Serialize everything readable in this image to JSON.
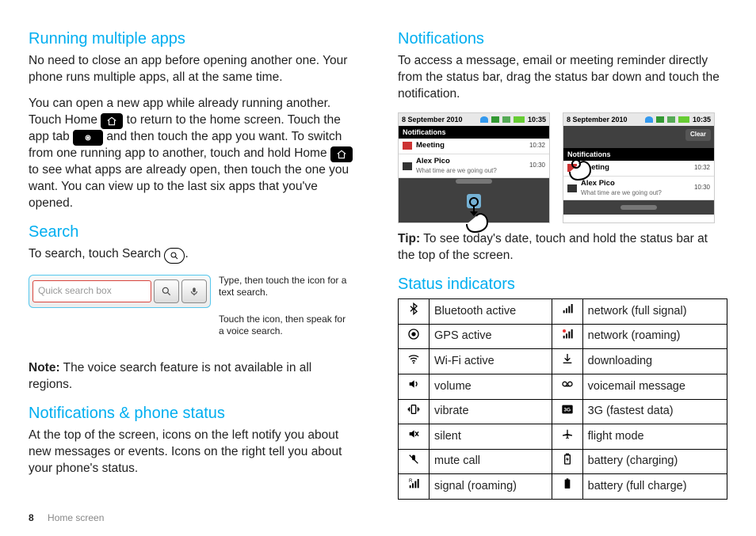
{
  "left": {
    "h_running": "Running multiple apps",
    "p_running_1": "No need to close an app before opening another one. Your phone runs multiple apps, all at the same time.",
    "p_running_2a": "You can open a new app while already running another. Touch Home ",
    "p_running_2b": " to return to the home screen. Touch the app tab ",
    "p_running_2c": " and then touch the app you want. To switch from one running app to another, touch and hold Home ",
    "p_running_2d": " to see what apps are already open, then touch the one you want. You can view up to the last six apps that you've opened.",
    "h_search": "Search",
    "p_search_1a": "To search, touch Search ",
    "p_search_1b": ".",
    "searchbox_placeholder": "Quick search box",
    "search_annot_1": "Type, then touch the icon for a text search.",
    "search_annot_2": "Touch the icon, then speak for a voice search.",
    "note_label": "Note:",
    "note_text": " The voice search feature is not available in all regions.",
    "h_notifstatus": "Notifications & phone status",
    "p_notifstatus": "At the top of the screen, icons on the left notify you about new messages or events. Icons on the right tell you about your phone's status."
  },
  "right": {
    "h_notif": "Notifications",
    "p_notif": "To access a message, email or meeting reminder directly from the status bar, drag the status bar down and touch the notification.",
    "phone_date": "8 September 2010",
    "phone_time": "10:35",
    "shade_title": "Notifications",
    "clear_label": "Clear",
    "n1_label": "Meeting",
    "n1_time": "10:32",
    "n2_label": "Alex Pico",
    "n2_sub": "What time are we going out?",
    "n2_time": "10:30",
    "tip_label": "Tip:",
    "tip_text": " To see today's date, touch and hold the status bar at the top of the screen.",
    "h_status": "Status indicators",
    "rows": [
      {
        "l": "Bluetooth active",
        "r": "network (full signal)"
      },
      {
        "l": "GPS active",
        "r": "network (roaming)"
      },
      {
        "l": "Wi-Fi active",
        "r": "downloading"
      },
      {
        "l": "volume",
        "r": "voicemail message"
      },
      {
        "l": "vibrate",
        "r": "3G (fastest data)"
      },
      {
        "l": "silent",
        "r": "flight mode"
      },
      {
        "l": "mute call",
        "r": "battery (charging)"
      },
      {
        "l": "signal (roaming)",
        "r": "battery (full charge)"
      }
    ],
    "icons_l": [
      "bluetooth",
      "gps",
      "wifi",
      "volume",
      "vibrate",
      "silent",
      "mute",
      "roam-sig"
    ],
    "icons_r": [
      "signal",
      "signal-roam",
      "download",
      "voicemail",
      "threeg",
      "flight",
      "bat-chg",
      "bat-full"
    ]
  },
  "footer": {
    "page": "8",
    "section": "Home screen"
  }
}
